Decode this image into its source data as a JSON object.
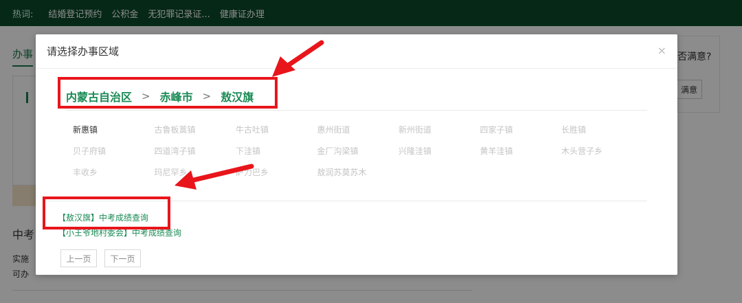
{
  "hotbar": {
    "label": "热词:",
    "items": [
      "结婚登记预约",
      "公积金",
      "无犯罪记录证...",
      "健康证办理"
    ]
  },
  "background": {
    "tab_label": "办事",
    "page_title": "中考",
    "line1": "实施",
    "line2": "可办",
    "right_question": "否满意?",
    "right_button": "满意"
  },
  "modal": {
    "title": "请选择办事区域",
    "close_label": "×",
    "breadcrumb": [
      "内蒙古自治区",
      "赤峰市",
      "敖汉旗"
    ],
    "breadcrumb_separator": ">",
    "towns": [
      "新惠镇",
      "古鲁板蒿镇",
      "牛古吐镇",
      "惠州街道",
      "新州街道",
      "四家子镇",
      "长胜镇",
      "贝子府镇",
      "四道湾子镇",
      "下洼镇",
      "金厂沟梁镇",
      "兴隆洼镇",
      "黄羊洼镇",
      "木头营子乡",
      "丰收乡",
      "玛尼罕乡",
      "萨力巴乡",
      "敖润苏莫苏木"
    ],
    "active_town": "新惠镇",
    "results": [
      "【敖汉旗】中考成绩查询",
      "【小王爷地村委会】中考成绩查询"
    ],
    "pager": {
      "prev": "上一页",
      "next": "下一页"
    }
  },
  "colors": {
    "hotbar_bg": "#0b4a2a",
    "accent_green": "#1a8a55",
    "annotation_red": "#e8151b"
  }
}
